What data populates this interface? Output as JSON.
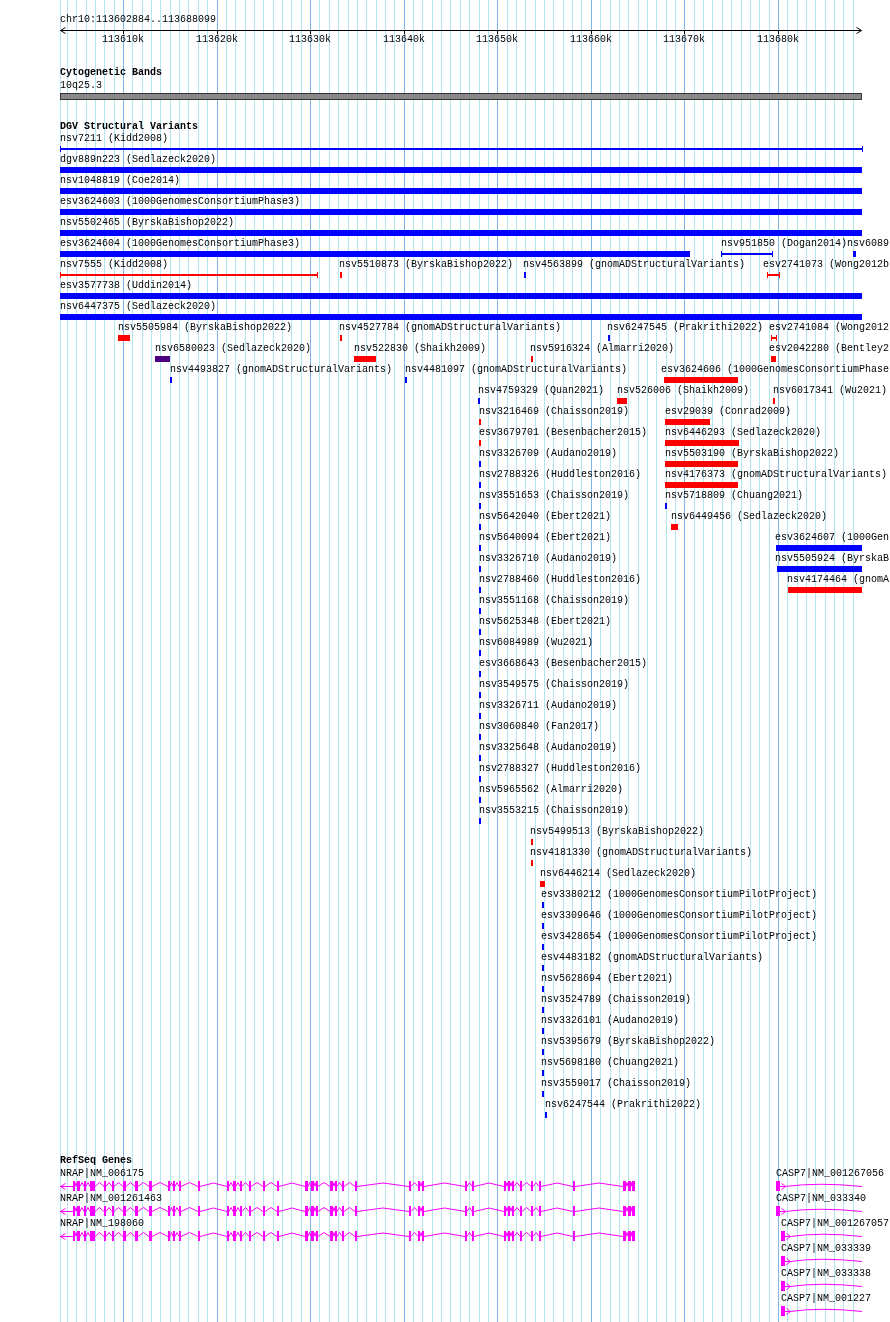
{
  "ruler": {
    "location": "chr10:113602884..113688099",
    "ticks": [
      "113610k",
      "113620k",
      "113630k",
      "113640k",
      "113650k",
      "113660k",
      "113670k",
      "113680k"
    ]
  },
  "cytogenetic_bands": {
    "title": "Cytogenetic Bands",
    "band": "10q25.3"
  },
  "dgv": {
    "title": "DGV Structural Variants",
    "lanes": [
      {
        "features": [
          {
            "label": "nsv7211 (Kidd2008)",
            "kind": "span",
            "color": "#0000ff"
          }
        ]
      },
      {
        "features": [
          {
            "label": "dgv889n223 (Sedlazeck2020)",
            "kind": "bar",
            "color": "#0000ff"
          }
        ]
      },
      {
        "features": [
          {
            "label": "nsv1048819 (Coe2014)",
            "kind": "bar",
            "color": "#0000ff"
          }
        ]
      },
      {
        "features": [
          {
            "label": "esv3624603 (1000GenomesConsortiumPhase3)",
            "kind": "bar",
            "color": "#0000ff"
          }
        ]
      },
      {
        "features": [
          {
            "label": "nsv5502465 (ByrskaBishop2022)",
            "kind": "bar",
            "color": "#0000ff"
          }
        ]
      },
      {
        "features": [
          {
            "label": "esv3624604 (1000GenomesConsortiumPhase3)",
            "kind": "bar",
            "color": "#0000ff"
          },
          {
            "label": "nsv951850 (Dogan2014)",
            "kind": "span",
            "color": "#0000ff"
          },
          {
            "label": "nsv6089",
            "kind": "bar",
            "color": "#0000ff"
          }
        ]
      },
      {
        "features": [
          {
            "label": "nsv7555 (Kidd2008)",
            "kind": "span",
            "color": "#ff0000"
          },
          {
            "label": "nsv5510873 (ByrskaBishop2022)",
            "kind": "bar",
            "color": "#ff0000"
          },
          {
            "label": "nsv4563899 (gnomADStructuralVariants)",
            "kind": "bar",
            "color": "#0000ff"
          },
          {
            "label": "esv2741073 (Wong2012b",
            "kind": "span",
            "color": "#ff0000"
          }
        ]
      },
      {
        "features": [
          {
            "label": "esv3577738 (Uddin2014)",
            "kind": "bar",
            "color": "#0000ff"
          }
        ]
      },
      {
        "features": [
          {
            "label": "nsv6447375 (Sedlazeck2020)",
            "kind": "bar",
            "color": "#0000ff"
          }
        ]
      },
      {
        "features": [
          {
            "label": "nsv5505984 (ByrskaBishop2022)",
            "kind": "bar",
            "color": "#ff0000"
          },
          {
            "label": "nsv4527784 (gnomADStructuralVariants)",
            "kind": "bar",
            "color": "#ff0000"
          },
          {
            "label": "nsv6247545 (Prakrithi2022)",
            "kind": "bar",
            "color": "#0000ff"
          },
          {
            "label": "esv2741084 (Wong2012",
            "kind": "span",
            "color": "#ff0000"
          }
        ]
      },
      {
        "features": [
          {
            "label": "nsv6580023 (Sedlazeck2020)",
            "kind": "bar",
            "color": "#4b0082"
          },
          {
            "label": "nsv522830 (Shaikh2009)",
            "kind": "bar",
            "color": "#ff0000"
          },
          {
            "label": "nsv5916324 (Almarri2020)",
            "kind": "bar",
            "color": "#ff0000"
          },
          {
            "label": "esv2042280 (Bentley2",
            "kind": "bar",
            "color": "#ff0000"
          }
        ]
      },
      {
        "features": [
          {
            "label": "nsv4493827 (gnomADStructuralVariants)",
            "kind": "bar",
            "color": "#0000ff"
          },
          {
            "label": "nsv4481097 (gnomADStructuralVariants)",
            "kind": "bar",
            "color": "#0000ff"
          },
          {
            "label": "esv3624606 (1000GenomesConsortiumPhase",
            "kind": "bar",
            "color": "#ff0000"
          }
        ]
      },
      {
        "features": [
          {
            "label": "nsv4759329 (Quan2021)",
            "kind": "bar",
            "color": "#0000ff"
          },
          {
            "label": "nsv526006 (Shaikh2009)",
            "kind": "bar",
            "color": "#ff0000"
          },
          {
            "label": "nsv6017341 (Wu2021)",
            "kind": "bar",
            "color": "#ff0000"
          }
        ]
      },
      {
        "features": [
          {
            "label": "nsv3216469 (Chaisson2019)",
            "kind": "bar",
            "color": "#ff0000"
          },
          {
            "label": "esv29039 (Conrad2009)",
            "kind": "bar",
            "color": "#ff0000"
          }
        ]
      },
      {
        "features": [
          {
            "label": "esv3679701 (Besenbacher2015)",
            "kind": "bar",
            "color": "#ff0000"
          },
          {
            "label": "nsv6446293 (Sedlazeck2020)",
            "kind": "bar",
            "color": "#ff0000"
          }
        ]
      },
      {
        "features": [
          {
            "label": "nsv3326709 (Audano2019)",
            "kind": "bar",
            "color": "#0000ff"
          },
          {
            "label": "nsv5503190 (ByrskaBishop2022)",
            "kind": "bar",
            "color": "#ff0000"
          }
        ]
      },
      {
        "features": [
          {
            "label": "nsv2788326 (Huddleston2016)",
            "kind": "bar",
            "color": "#0000ff"
          },
          {
            "label": "nsv4176373 (gnomADStructuralVariants)",
            "kind": "bar",
            "color": "#ff0000"
          }
        ]
      },
      {
        "features": [
          {
            "label": "nsv3551653 (Chaisson2019)",
            "kind": "bar",
            "color": "#0000ff"
          },
          {
            "label": "nsv5718809 (Chuang2021)",
            "kind": "bar",
            "color": "#0000ff"
          }
        ]
      },
      {
        "features": [
          {
            "label": "nsv5642040 (Ebert2021)",
            "kind": "bar",
            "color": "#0000ff"
          },
          {
            "label": "nsv6449456 (Sedlazeck2020)",
            "kind": "bar",
            "color": "#ff0000"
          }
        ]
      },
      {
        "features": [
          {
            "label": "nsv5640094 (Ebert2021)",
            "kind": "bar",
            "color": "#0000ff"
          },
          {
            "label": "esv3624607 (1000Gen",
            "kind": "bar",
            "color": "#0000ff"
          }
        ]
      },
      {
        "features": [
          {
            "label": "nsv3326710 (Audano2019)",
            "kind": "bar",
            "color": "#0000ff"
          },
          {
            "label": "nsv5505924 (ByrskaB",
            "kind": "bar",
            "color": "#0000ff"
          }
        ]
      },
      {
        "features": [
          {
            "label": "nsv2788460 (Huddleston2016)",
            "kind": "bar",
            "color": "#0000ff"
          },
          {
            "label": "nsv4174464 (gnomA",
            "kind": "bar",
            "color": "#ff0000"
          }
        ]
      },
      {
        "features": [
          {
            "label": "nsv3551168 (Chaisson2019)",
            "kind": "bar",
            "color": "#0000ff"
          }
        ]
      },
      {
        "features": [
          {
            "label": "nsv5625348 (Ebert2021)",
            "kind": "bar",
            "color": "#0000ff"
          }
        ]
      },
      {
        "features": [
          {
            "label": "nsv6084989 (Wu2021)",
            "kind": "bar",
            "color": "#0000ff"
          }
        ]
      },
      {
        "features": [
          {
            "label": "esv3668643 (Besenbacher2015)",
            "kind": "bar",
            "color": "#0000ff"
          }
        ]
      },
      {
        "features": [
          {
            "label": "nsv3549575 (Chaisson2019)",
            "kind": "bar",
            "color": "#0000ff"
          }
        ]
      },
      {
        "features": [
          {
            "label": "nsv3326711 (Audano2019)",
            "kind": "bar",
            "color": "#0000ff"
          }
        ]
      },
      {
        "features": [
          {
            "label": "nsv3060840 (Fan2017)",
            "kind": "bar",
            "color": "#0000ff"
          }
        ]
      },
      {
        "features": [
          {
            "label": "nsv3325648 (Audano2019)",
            "kind": "bar",
            "color": "#0000ff"
          }
        ]
      },
      {
        "features": [
          {
            "label": "nsv2788327 (Huddleston2016)",
            "kind": "bar",
            "color": "#0000ff"
          }
        ]
      },
      {
        "features": [
          {
            "label": "nsv5965562 (Almarri2020)",
            "kind": "bar",
            "color": "#0000ff"
          }
        ]
      },
      {
        "features": [
          {
            "label": "nsv3553215 (Chaisson2019)",
            "kind": "bar",
            "color": "#0000ff"
          }
        ]
      },
      {
        "features": [
          {
            "label": "nsv5499513 (ByrskaBishop2022)",
            "kind": "bar",
            "color": "#ff0000"
          }
        ]
      },
      {
        "features": [
          {
            "label": "nsv4181330 (gnomADStructuralVariants)",
            "kind": "bar",
            "color": "#ff0000"
          }
        ]
      },
      {
        "features": [
          {
            "label": "nsv6446214 (Sedlazeck2020)",
            "kind": "bar",
            "color": "#ff0000"
          }
        ]
      },
      {
        "features": [
          {
            "label": "esv3380212 (1000GenomesConsortiumPilotProject)",
            "kind": "bar",
            "color": "#0000ff"
          }
        ]
      },
      {
        "features": [
          {
            "label": "esv3309646 (1000GenomesConsortiumPilotProject)",
            "kind": "bar",
            "color": "#0000ff"
          }
        ]
      },
      {
        "features": [
          {
            "label": "esv3428654 (1000GenomesConsortiumPilotProject)",
            "kind": "bar",
            "color": "#0000ff"
          }
        ]
      },
      {
        "features": [
          {
            "label": "esv4483182 (gnomADStructuralVariants)",
            "kind": "bar",
            "color": "#0000ff"
          }
        ]
      },
      {
        "features": [
          {
            "label": "nsv5628694 (Ebert2021)",
            "kind": "bar",
            "color": "#0000ff"
          }
        ]
      },
      {
        "features": [
          {
            "label": "nsv3524789 (Chaisson2019)",
            "kind": "bar",
            "color": "#0000ff"
          }
        ]
      },
      {
        "features": [
          {
            "label": "nsv3326101 (Audano2019)",
            "kind": "bar",
            "color": "#0000ff"
          }
        ]
      },
      {
        "features": [
          {
            "label": "nsv5395679 (ByrskaBishop2022)",
            "kind": "bar",
            "color": "#0000ff"
          }
        ]
      },
      {
        "features": [
          {
            "label": "nsv5698180 (Chuang2021)",
            "kind": "bar",
            "color": "#0000ff"
          }
        ]
      },
      {
        "features": [
          {
            "label": "nsv3559017 (Chaisson2019)",
            "kind": "bar",
            "color": "#0000ff"
          }
        ]
      },
      {
        "features": [
          {
            "label": "nsv6247544 (Prakrithi2022)",
            "kind": "bar",
            "color": "#0000ff"
          }
        ]
      }
    ]
  },
  "refseq_genes": {
    "title": "RefSeq Genes",
    "lanes": [
      {
        "features": [
          {
            "label": "NRAP|NM_006175",
            "kind": "reverse"
          },
          {
            "label": "CASP7|NM_001267056",
            "kind": "forward"
          }
        ]
      },
      {
        "features": [
          {
            "label": "NRAP|NM_001261463",
            "kind": "reverse"
          },
          {
            "label": "CASP7|NM_033340",
            "kind": "forward"
          }
        ]
      },
      {
        "features": [
          {
            "label": "NRAP|NM_198060",
            "kind": "reverse"
          },
          {
            "label": "CASP7|NM_001267057",
            "kind": "forward"
          }
        ]
      },
      {
        "features": [
          {
            "label": "CASP7|NM_033339",
            "kind": "forward"
          }
        ]
      },
      {
        "features": [
          {
            "label": "CASP7|NM_033338",
            "kind": "forward"
          }
        ]
      },
      {
        "features": [
          {
            "label": "CASP7|NM_001227",
            "kind": "forward"
          }
        ]
      }
    ]
  }
}
